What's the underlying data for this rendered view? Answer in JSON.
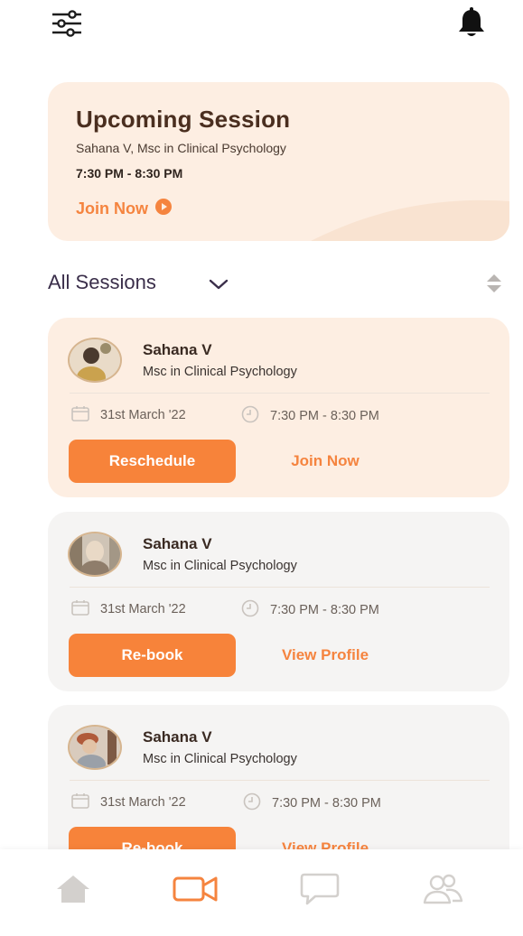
{
  "upcoming": {
    "title": "Upcoming Session",
    "subtitle": "Sahana V, Msc in Clinical Psychology",
    "time": "7:30 PM - 8:30 PM",
    "join_label": "Join Now"
  },
  "sessions_header": {
    "title": "All Sessions"
  },
  "sessions": [
    {
      "name": "Sahana V",
      "degree": "Msc in Clinical Psychology",
      "date": "31st March '22",
      "time": "7:30 PM - 8:30 PM",
      "primary_label": "Reschedule",
      "secondary_label": "Join Now"
    },
    {
      "name": "Sahana V",
      "degree": "Msc in Clinical Psychology",
      "date": "31st March '22",
      "time": "7:30 PM - 8:30 PM",
      "primary_label": "Re-book",
      "secondary_label": "View Profile"
    },
    {
      "name": "Sahana V",
      "degree": "Msc in Clinical Psychology",
      "date": "31st March '22",
      "time": "7:30 PM - 8:30 PM",
      "primary_label": "Re-book",
      "secondary_label": "View Profile"
    }
  ],
  "bottom_nav": {
    "items": [
      "home-icon",
      "video-icon",
      "chat-icon",
      "community-icon"
    ],
    "active": "video-icon"
  },
  "colors": {
    "accent": "#f7833a",
    "active_card": "#fdeee2",
    "past_card": "#f5f4f3",
    "title_brown": "#4a2e1f"
  }
}
